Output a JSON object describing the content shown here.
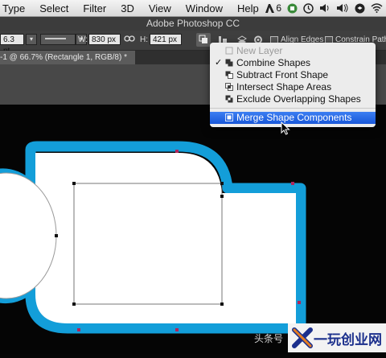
{
  "menubar": {
    "items": [
      "Type",
      "Select",
      "Filter",
      "3D",
      "View",
      "Window",
      "Help"
    ],
    "status": {
      "adobe_count": "6"
    }
  },
  "window": {
    "title": "Adobe Photoshop CC"
  },
  "options_bar": {
    "stroke_width": "6.3 pt",
    "w_label": "W:",
    "w_value": "830 px",
    "h_label": "H:",
    "h_value": "421 px",
    "align_edges": "Align Edges",
    "constrain": "Constrain Path Dr"
  },
  "document_tab": {
    "label": "-1 @ 66.7% (Rectangle 1, RGB/8) *"
  },
  "path_ops_menu": {
    "items": [
      {
        "label": "New Layer",
        "checked": false,
        "disabled": true,
        "highlighted": false
      },
      {
        "label": "Combine Shapes",
        "checked": true,
        "disabled": false,
        "highlighted": false
      },
      {
        "label": "Subtract Front Shape",
        "checked": false,
        "disabled": false,
        "highlighted": false
      },
      {
        "label": "Intersect Shape Areas",
        "checked": false,
        "disabled": false,
        "highlighted": false
      },
      {
        "label": "Exclude Overlapping Shapes",
        "checked": false,
        "disabled": false,
        "highlighted": false
      },
      {
        "label": "Merge Shape Components",
        "checked": false,
        "disabled": false,
        "highlighted": true
      }
    ],
    "check_mark": "✓"
  },
  "watermark": {
    "prefix": "头条号",
    "brand": "一玩创业网"
  },
  "colors": {
    "shape_stroke": "#139ed9",
    "shape_fill": "#ffffff",
    "menu_highlight": "#2a6ae8"
  }
}
